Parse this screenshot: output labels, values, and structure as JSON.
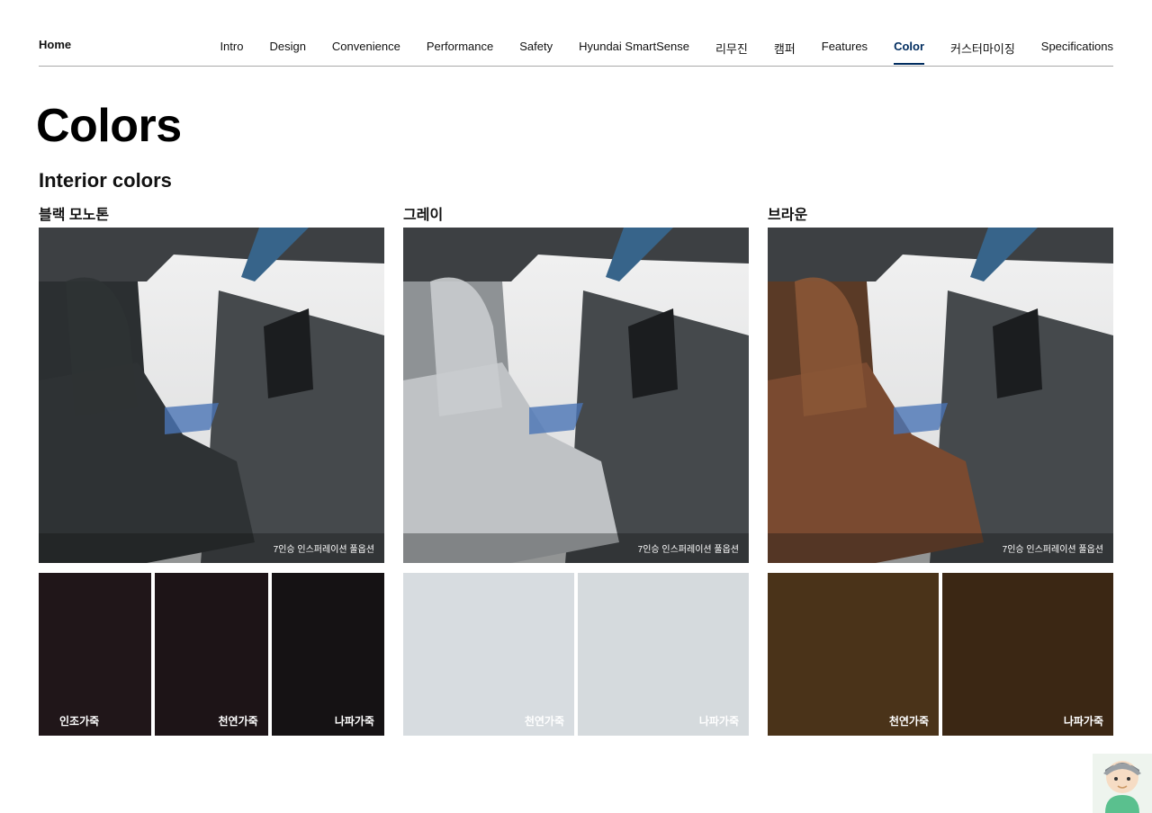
{
  "nav": {
    "home": "Home",
    "items": [
      {
        "label": "Intro",
        "active": false
      },
      {
        "label": "Design",
        "active": false
      },
      {
        "label": "Convenience",
        "active": false
      },
      {
        "label": "Performance",
        "active": false
      },
      {
        "label": "Safety",
        "active": false
      },
      {
        "label": "Hyundai SmartSense",
        "active": false
      },
      {
        "label": "리무진",
        "active": false
      },
      {
        "label": "캠퍼",
        "active": false
      },
      {
        "label": "Features",
        "active": false
      },
      {
        "label": "Color",
        "active": true
      },
      {
        "label": "커스터마이징",
        "active": false
      },
      {
        "label": "Specifications",
        "active": false
      }
    ]
  },
  "page_title": "Colors",
  "section_title": "Interior colors",
  "groups": [
    {
      "name": "블랙 모노톤",
      "caption": "7인승 인스퍼레이션 풀옵션",
      "seat_color": "#2e3234",
      "swatches": [
        {
          "label": "인조가죽",
          "color": "#201619"
        },
        {
          "label": "천연가죽",
          "color": "#1d1417"
        },
        {
          "label": "나파가죽",
          "color": "#151214"
        }
      ]
    },
    {
      "name": "그레이",
      "caption": "7인승 인스퍼레이션 풀옵션",
      "seat_color": "#bfc2c5",
      "swatches": [
        {
          "label": "천연가죽",
          "color": "#d7dce0"
        },
        {
          "label": "나파가죽",
          "color": "#d5dadd"
        }
      ]
    },
    {
      "name": "브라운",
      "caption": "7인승 인스퍼레이션 풀옵션",
      "seat_color": "#7a4a30",
      "swatches": [
        {
          "label": "천연가죽",
          "color": "#4a3319"
        },
        {
          "label": "나파가죽",
          "color": "#3b2714"
        }
      ]
    }
  ]
}
